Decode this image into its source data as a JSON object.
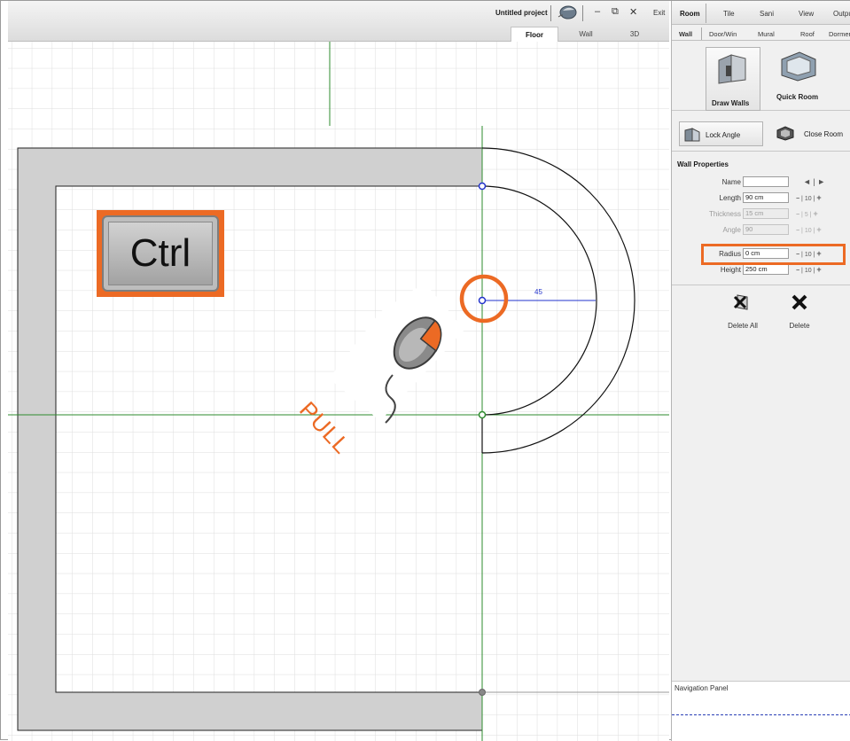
{
  "app": {
    "project_title": "Untitled project",
    "exit_label": "Exit",
    "view_tabs": [
      "Floor",
      "Wall",
      "3D"
    ],
    "active_view": "Floor"
  },
  "canvas": {
    "ctrl_key_label": "Ctrl",
    "pull_label": "PULL",
    "dimension_value": "45",
    "accent_color": "#ec6a24",
    "wall_fill_color": "#d0d0d0",
    "guide_line_color": "#2e8b2e",
    "dimension_color": "#2233cc"
  },
  "panel": {
    "main_tabs": [
      "Room",
      "Tile",
      "Sani",
      "View",
      "Output"
    ],
    "active_main_tab": "Room",
    "sub_tabs": [
      "Wall",
      "Door/Win",
      "Mural",
      "Roof",
      "Dormer"
    ],
    "active_sub_tab": "Wall",
    "tools": {
      "draw_walls_label": "Draw Walls",
      "quick_room_label": "Quick Room",
      "lock_angle_label": "Lock Angle",
      "close_room_label": "Close Room"
    },
    "wall_properties": {
      "title": "Wall Properties",
      "name_label": "Name",
      "name_value": "",
      "name_nav": "◄ | ►",
      "rows": [
        {
          "label": "Length",
          "value": "90 cm",
          "step": "10",
          "enabled": true
        },
        {
          "label": "Thickness",
          "value": "15 cm",
          "step": "5",
          "enabled": false
        },
        {
          "label": "Angle",
          "value": "90",
          "step": "10",
          "enabled": false
        },
        {
          "label": "Radius",
          "value": "0 cm",
          "step": "10",
          "enabled": true
        },
        {
          "label": "Height",
          "value": "250 cm",
          "step": "10",
          "enabled": true
        }
      ]
    },
    "actions": {
      "delete_all_label": "Delete All",
      "delete_label": "Delete"
    },
    "navigation_panel_title": "Navigation Panel"
  }
}
